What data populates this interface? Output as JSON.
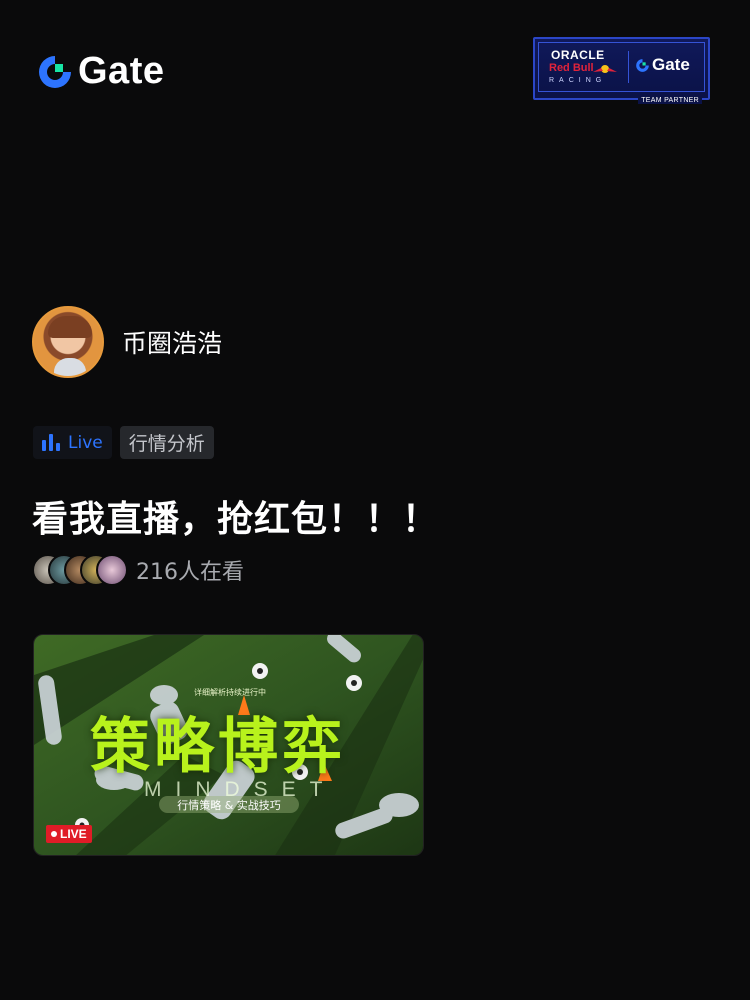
{
  "brand": {
    "name": "Gate",
    "accent": "#17e5a6",
    "primary": "#2d74ff"
  },
  "partner_badge": {
    "oracle": "ORACLE",
    "redbull": "Red Bull",
    "racing": "RACING",
    "gate": "Gate",
    "team": "TEAM PARTNER"
  },
  "author": {
    "name": "币圈浩浩",
    "avatar_icon": "avatar-woman"
  },
  "tags": {
    "live": "Live",
    "category": "行情分析"
  },
  "headline": "看我直播，抢红包！！！",
  "viewers": {
    "count_text": "216人在看"
  },
  "cover": {
    "subtitle": "详细解析持续进行中",
    "title": "策略博弈",
    "english": "MINDSET",
    "pill": "行情策略 & 实战技巧",
    "live_label": "LIVE"
  }
}
